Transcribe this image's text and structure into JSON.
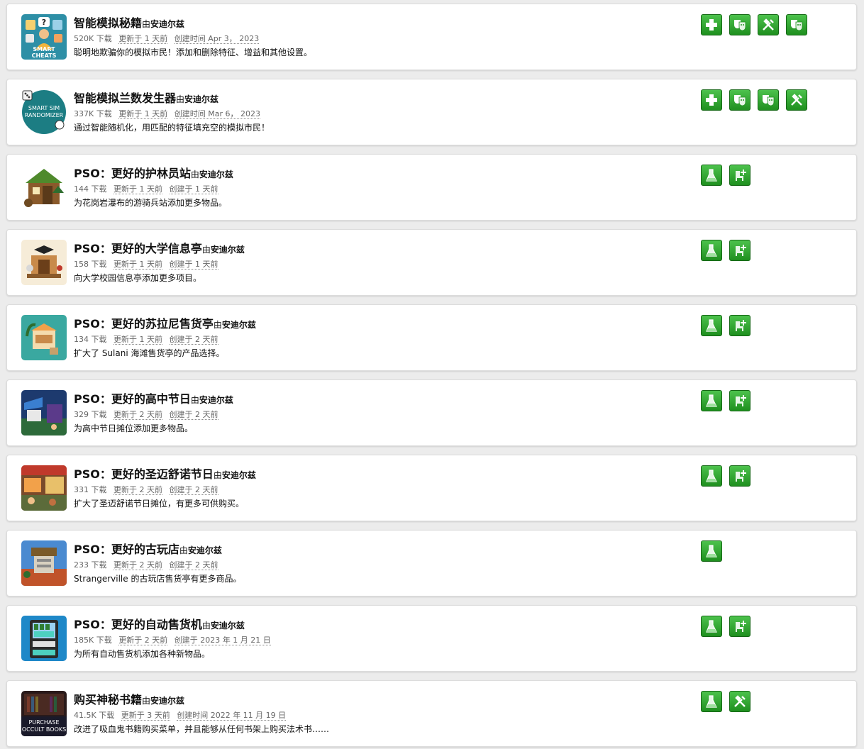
{
  "ui": {
    "by_prefix": "由",
    "accent": "#2aa22a"
  },
  "mods": [
    {
      "name": "智能模拟秘籍",
      "author": "安迪尔兹",
      "downloads": "520K 下载",
      "updated": "更新于 1 天前",
      "created": "创建时间 Apr 3， 2023",
      "description": "聪明地欺骗你的模拟市民！添加和删除特征、增益和其他设置。",
      "thumb_text": [
        "SMART",
        "CHEATS"
      ],
      "tags": [
        "plus-icon",
        "drama-masks-icon",
        "tools-icon",
        "drama-masks-icon"
      ]
    },
    {
      "name": "智能模拟兰数发生器",
      "author": "安迪尔兹",
      "downloads": "337K 下载",
      "updated": "更新于 1 天前",
      "created": "创建时间 Mar 6， 2023",
      "description": "通过智能随机化，用匹配的特征填充空的模拟市民！",
      "thumb_text": [
        "SMART SIM",
        "RANDOMIZER"
      ],
      "tags": [
        "plus-icon",
        "drama-masks-icon",
        "drama-masks-icon",
        "tools-icon"
      ]
    },
    {
      "name": "PSO：更好的护林员站",
      "author": "安迪尔兹",
      "downloads": "144 下载",
      "updated": "更新于 1 天前",
      "created": "创建于 1 天前",
      "description": "为花岗岩瀑布的游骑兵站添加更多物品。",
      "thumb_text": [],
      "tags": [
        "flask-icon",
        "chair-plus-icon"
      ]
    },
    {
      "name": "PSO：更好的大学信息亭",
      "author": "安迪尔兹",
      "downloads": "158 下载",
      "updated": "更新于 1 天前",
      "created": "创建于 1 天前",
      "description": "向大学校园信息亭添加更多项目。",
      "thumb_text": [],
      "tags": [
        "flask-icon",
        "chair-plus-icon"
      ]
    },
    {
      "name": "PSO：更好的苏拉尼售货亭",
      "author": "安迪尔兹",
      "downloads": "134 下载",
      "updated": "更新于 1 天前",
      "created": "创建于 2 天前",
      "description": "扩大了 Sulani 海滩售货亭的产品选择。",
      "thumb_text": [],
      "tags": [
        "flask-icon",
        "chair-plus-icon"
      ]
    },
    {
      "name": "PSO：更好的高中节日",
      "author": "安迪尔兹",
      "downloads": "329 下载",
      "updated": "更新于 2 天前",
      "created": "创建于 2 天前",
      "description": "为高中节日摊位添加更多物品。",
      "thumb_text": [],
      "tags": [
        "flask-icon",
        "chair-plus-icon"
      ]
    },
    {
      "name": "PSO：更好的圣迈舒诺节日",
      "author": "安迪尔兹",
      "downloads": "331 下载",
      "updated": "更新于 2 天前",
      "created": "创建于 2 天前",
      "description": "扩大了圣迈舒诺节日摊位，有更多可供购买。",
      "thumb_text": [],
      "tags": [
        "flask-icon",
        "chair-plus-icon"
      ]
    },
    {
      "name": "PSO：更好的古玩店",
      "author": "安迪尔兹",
      "downloads": "233 下载",
      "updated": "更新于 2 天前",
      "created": "创建于 2 天前",
      "description": "Strangerville 的古玩店售货亭有更多商品。",
      "thumb_text": [],
      "tags": [
        "flask-icon"
      ]
    },
    {
      "name": "PSO：更好的自动售货机",
      "author": "安迪尔兹",
      "downloads": "185K 下载",
      "updated": "更新于 2 天前",
      "created": "创建于 2023 年 1 月 21 日",
      "description": "为所有自动售货机添加各种新物品。",
      "thumb_text": [],
      "tags": [
        "flask-icon",
        "chair-plus-icon"
      ]
    },
    {
      "name": "购买神秘书籍",
      "author": "安迪尔兹",
      "downloads": "41.5K 下载",
      "updated": "更新于 3 天前",
      "created": "创建时间 2022 年 11 月 19 日",
      "description": "改进了吸血鬼书籍购买菜单，并且能够从任何书架上购买法术书……",
      "thumb_text": [
        "PURCHASE",
        "OCCULT BOOKS"
      ],
      "tags": [
        "flask-icon",
        "tools-icon"
      ]
    }
  ]
}
